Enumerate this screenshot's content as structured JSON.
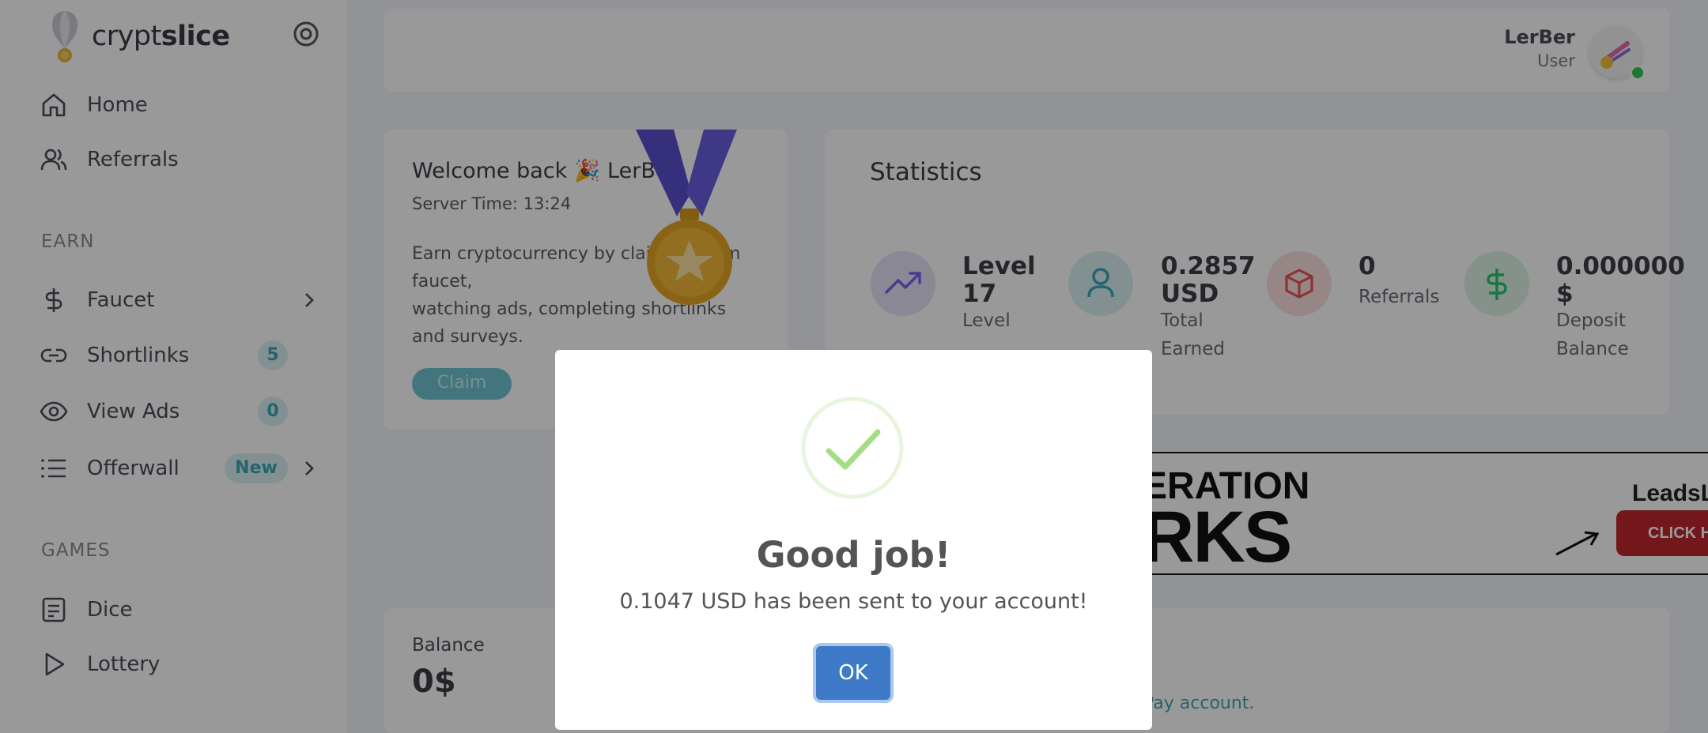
{
  "brand": {
    "name_light": "crypt",
    "name_bold": "slice"
  },
  "sidebar": {
    "items": [
      {
        "label": "Home"
      },
      {
        "label": "Referrals"
      }
    ],
    "section_earn": "EARN",
    "earn_items": [
      {
        "label": "Faucet"
      },
      {
        "label": "Shortlinks",
        "badge": "5"
      },
      {
        "label": "View Ads",
        "badge": "0"
      },
      {
        "label": "Offerwall",
        "badge": "New"
      }
    ],
    "section_games": "GAMES",
    "game_items": [
      {
        "label": "Dice"
      },
      {
        "label": "Lottery"
      }
    ]
  },
  "header": {
    "user_name": "LerBer",
    "user_role": "User"
  },
  "welcome": {
    "title": "Welcome back 🎉 LerBer",
    "server_time": "Server Time: 13:24",
    "desc_line1": "Earn cryptocurrency by claiming from faucet,",
    "desc_line2": "watching ads, completing shortlinks",
    "desc_line3": "and surveys.",
    "claim_label": "Claim"
  },
  "statistics": {
    "title": "Statistics",
    "items": [
      {
        "value_line1": "Level",
        "value_line2": "17",
        "label_line1": "Level",
        "label_line2": ""
      },
      {
        "value_line1": "0.2857",
        "value_line2": "USD",
        "label_line1": "Total",
        "label_line2": "Earned"
      },
      {
        "value_line1": "0",
        "value_line2": "",
        "label_line1": "Referrals",
        "label_line2": ""
      },
      {
        "value_line1": "0.000000",
        "value_line2": "$",
        "label_line1": "Deposit",
        "label_line2": "Balance"
      }
    ]
  },
  "ad_banner": {
    "text_top": "ERATION",
    "text_bottom": "RKS",
    "brand": "LeadsLe",
    "cta": "CLICK H"
  },
  "balance": {
    "label": "Balance",
    "value": "0$",
    "link_tail": "Pay account."
  },
  "modal": {
    "title": "Good job!",
    "message": "0.1047 USD has been sent to your account!",
    "ok_label": "OK"
  },
  "colors": {
    "accent": "#3fa7b6",
    "ok_button": "#3e7ac7",
    "success_check": "#a5dc86",
    "online_dot": "#34c759",
    "level_circle": "#e6e3f7",
    "earned_circle": "#d9f1f4",
    "referrals_circle": "#fbe0e0",
    "deposit_circle": "#ddf4e6"
  }
}
